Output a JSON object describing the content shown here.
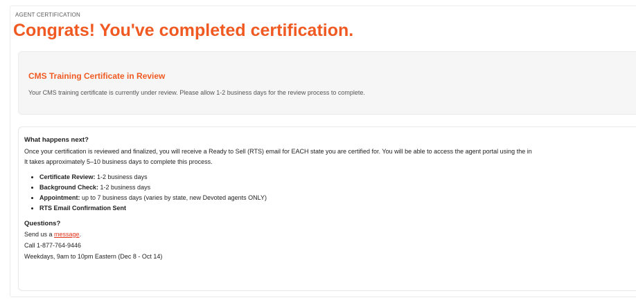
{
  "header": {
    "eyebrow": "AGENT CERTIFICATION",
    "title": "Congrats! You've completed certification."
  },
  "review": {
    "title": "CMS Training Certificate in Review",
    "text": "Your CMS training certificate is currently under review. Please allow 1-2 business days for the review process to complete."
  },
  "next": {
    "heading": "What happens next?",
    "line1": "Once your certification is reviewed and finalized, you will receive a Ready to Sell (RTS) email for EACH state you are certified for. You will be able to access the agent portal using the in",
    "line2": "It takes approximately 5–10 business days to complete this process.",
    "steps": [
      {
        "label": "Certificate Review:",
        "value": " 1-2 business days"
      },
      {
        "label": "Background Check:",
        "value": " 1-2 business days"
      },
      {
        "label": "Appointment:",
        "value": " up to 7 business days (varies by state, new Devoted agents ONLY)"
      },
      {
        "label": "RTS Email Confirmation Sent",
        "value": ""
      }
    ]
  },
  "questions": {
    "heading": "Questions?",
    "send_prefix": "Send us a ",
    "link_text": "message",
    "send_suffix": ".",
    "phone": "Call 1-877-764-9446",
    "hours": "Weekdays, 9am to 10pm Eastern (Dec 8 - Oct 14)"
  },
  "colors": {
    "accent": "#f05a22",
    "link": "#e0331a",
    "card_bg": "#f6f6f6"
  }
}
